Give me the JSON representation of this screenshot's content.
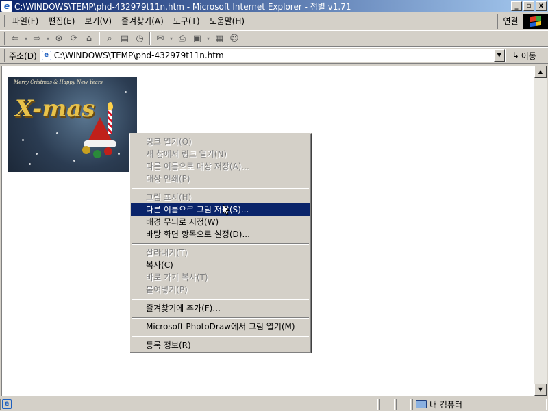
{
  "window": {
    "title": "C:\\WINDOWS\\TEMP\\phd-432979t11n.htm - Microsoft Internet Explorer - 점별 v1.71",
    "min_label": "_",
    "restore_label": "▫",
    "close_label": "x"
  },
  "menubar": {
    "items": [
      "파일(F)",
      "편집(E)",
      "보기(V)",
      "즐겨찾기(A)",
      "도구(T)",
      "도움말(H)"
    ],
    "connect_label": "연결"
  },
  "addressbar": {
    "label": "주소(D)",
    "url": "C:\\WINDOWS\\TEMP\\phd-432979t11n.htm",
    "go_label": "이동"
  },
  "image": {
    "caption": "Merry Cristmas & Happy New Years",
    "title": "X-mas"
  },
  "context_menu": {
    "groups": [
      [
        {
          "label": "링크 열기(O)",
          "enabled": false
        },
        {
          "label": "새 창에서 링크 열기(N)",
          "enabled": false
        },
        {
          "label": "다른 이름으로 대상 저장(A)...",
          "enabled": false
        },
        {
          "label": "대상 인쇄(P)",
          "enabled": false
        }
      ],
      [
        {
          "label": "그림 표시(H)",
          "enabled": false
        },
        {
          "label": "다른 이름으로 그림 저장(S)...",
          "enabled": true,
          "highlighted": true
        },
        {
          "label": "배경 무늬로 지정(W)",
          "enabled": true
        },
        {
          "label": "바탕 화면 항목으로 설정(D)...",
          "enabled": true
        }
      ],
      [
        {
          "label": "잘라내기(T)",
          "enabled": false
        },
        {
          "label": "복사(C)",
          "enabled": true
        },
        {
          "label": "바로 가기 복사(T)",
          "enabled": false
        },
        {
          "label": "붙여넣기(P)",
          "enabled": false
        }
      ],
      [
        {
          "label": "즐겨찾기에 추가(F)...",
          "enabled": true
        }
      ],
      [
        {
          "label": "Microsoft PhotoDraw에서 그림 열기(M)",
          "enabled": true
        }
      ],
      [
        {
          "label": "등록 정보(R)",
          "enabled": true
        }
      ]
    ]
  },
  "statusbar": {
    "zone_label": "내 컴퓨터"
  },
  "colors": {
    "title_bar": "#0a246a",
    "highlight": "#0a246a",
    "chrome": "#d4d0c8"
  }
}
